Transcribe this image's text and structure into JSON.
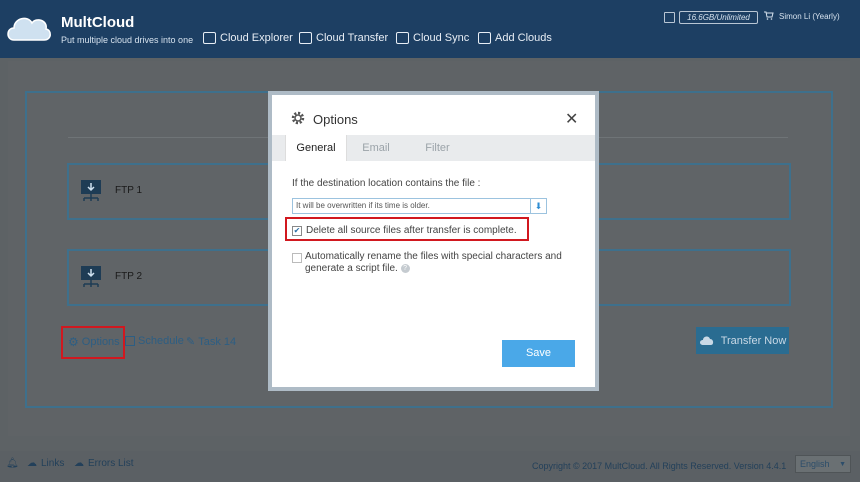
{
  "header": {
    "brand": "MultCloud",
    "tagline": "Put multiple cloud drives into one",
    "nav": [
      {
        "label": "Cloud Explorer"
      },
      {
        "label": "Cloud Transfer"
      },
      {
        "label": "Cloud Sync"
      },
      {
        "label": "Add Clouds"
      }
    ],
    "storage": "16.6GB/Unlimited",
    "user": "Simon Li (Yearly)"
  },
  "task": {
    "source_label": "FTP 1",
    "target_label": "FTP 2",
    "options_label": "Options",
    "schedule_label": "Schedule",
    "task_label": "Task 14",
    "transfer_button": "Transfer Now"
  },
  "footer": {
    "links_label": "Links",
    "errors_label": "Errors List",
    "copyright": "Copyright © 2017 MultCloud. All Rights Reserved. Version 4.4.1",
    "language": "English"
  },
  "modal": {
    "title": "Options",
    "tabs": [
      {
        "label": "General",
        "active": true
      },
      {
        "label": "Email",
        "active": false
      },
      {
        "label": "Filter",
        "active": false
      }
    ],
    "question": "If the destination location contains the file :",
    "select_value": "It will be overwritten if its time is older.",
    "delete_option": {
      "label": "Delete all source files after transfer is complete.",
      "checked": true
    },
    "rename_option": {
      "label": "Automatically rename the files with special characters and generate a script file.",
      "checked": false
    },
    "save_label": "Save"
  },
  "colors": {
    "header_bg": "#1d3f63",
    "accent_blue": "#4aa8e8",
    "highlight_red": "#d1181f"
  }
}
